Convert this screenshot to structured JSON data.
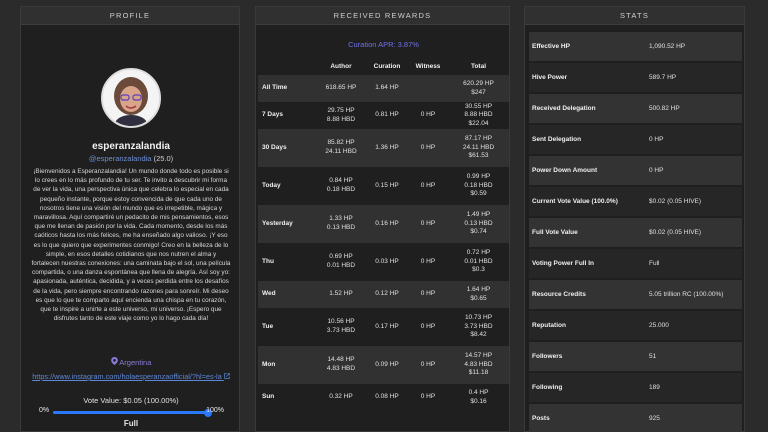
{
  "profile": {
    "header": "PROFILE",
    "name": "esperanzalandia",
    "handle": "@esperanzalandia",
    "reputation": "(25.0)",
    "about": "¡Bienvenidos a Esperanzalandia! Un mundo donde todo es posible si lo crees en lo más profundo de tu ser. Te invito a descubrir mi forma de ver la vida, una perspectiva única que celebra lo especial en cada pequeño instante, porque estoy convencida de que cada uno de nosotros tiene una visión del mundo que es irrepetible, mágica y maravillosa. Aquí compartiré un pedacito de mis pensamientos, esos que me llenan de pasión por la vida. Cada momento, desde los más caóticos hasta los más felices, me ha enseñado algo valioso. ¡Y eso es lo que quiero que experimentes conmigo! Creo en la belleza de lo simple, en esos detalles cotidianos que nos nutren el alma y fortalecen nuestras conexiones: una caminata bajo el sol, una película compartida, o una danza espontánea que llena de alegría. Así soy yo: apasionada, auténtica, decidida, y a veces perdida entre los desafíos de la vida, pero siempre encontrando razones para sonreír. Mi deseo es que lo que te comparto aquí encienda una chispa en tu corazón, que te inspire a unirte a este universo, mi universo. ¡Espero que disfrutes tanto de este viaje como yo lo hago cada día!",
    "location": "Argentina",
    "link": "https://www.instagram.com/holaesperanzaofficial/?hl=es-la",
    "vote_value": "Vote Value: $0.05 (100.00%)",
    "slider_min": "0%",
    "slider_max": "100%",
    "slider_value": 1.0,
    "power_label": "Full"
  },
  "rewards": {
    "header": "RECEIVED REWARDS",
    "apr": "Curation APR: 3.87%",
    "columns": [
      "",
      "Author",
      "Curation",
      "Witness",
      "Total"
    ],
    "rows": [
      {
        "label": "All Time",
        "author": [
          "618.65 HP"
        ],
        "curation": "1.64 HP",
        "witness": "",
        "total": [
          "620.29 HP",
          "$247"
        ]
      },
      {
        "label": "7 Days",
        "author": [
          "29.75 HP",
          "8.88 HBD"
        ],
        "curation": "0.81 HP",
        "witness": "0 HP",
        "total": [
          "30.55 HP",
          "8.88 HBD",
          "$22.04"
        ]
      },
      {
        "label": "30 Days",
        "author": [
          "85.82 HP",
          "24.11 HBD"
        ],
        "curation": "1.36 HP",
        "witness": "0 HP",
        "total": [
          "87.17 HP",
          "24.11 HBD",
          "$61.53"
        ]
      },
      {
        "label": "Today",
        "author": [
          "0.84 HP",
          "0.18 HBD"
        ],
        "curation": "0.15 HP",
        "witness": "0 HP",
        "total": [
          "0.99 HP",
          "0.18 HBD",
          "$0.59"
        ]
      },
      {
        "label": "Yesterday",
        "author": [
          "1.33 HP",
          "0.13 HBD"
        ],
        "curation": "0.16 HP",
        "witness": "0 HP",
        "total": [
          "1.49 HP",
          "0.13 HBD",
          "$0.74"
        ]
      },
      {
        "label": "Thu",
        "author": [
          "0.69 HP",
          "0.01 HBD"
        ],
        "curation": "0.03 HP",
        "witness": "0 HP",
        "total": [
          "0.72 HP",
          "0.01 HBD",
          "$0.3"
        ]
      },
      {
        "label": "Wed",
        "author": [
          "1.52 HP"
        ],
        "curation": "0.12 HP",
        "witness": "0 HP",
        "total": [
          "1.64 HP",
          "$0.65"
        ]
      },
      {
        "label": "Tue",
        "author": [
          "10.56 HP",
          "3.73 HBD"
        ],
        "curation": "0.17 HP",
        "witness": "0 HP",
        "total": [
          "10.73 HP",
          "3.73 HBD",
          "$8.42"
        ]
      },
      {
        "label": "Mon",
        "author": [
          "14.48 HP",
          "4.83 HBD"
        ],
        "curation": "0.09 HP",
        "witness": "0 HP",
        "total": [
          "14.57 HP",
          "4.83 HBD",
          "$11.18"
        ]
      },
      {
        "label": "Sun",
        "author": [
          "0.32 HP"
        ],
        "curation": "0.08 HP",
        "witness": "0 HP",
        "total": [
          "0.4 HP",
          "$0.16"
        ]
      }
    ]
  },
  "stats": {
    "header": "STATS",
    "rows": [
      {
        "key": "Effective HP",
        "value": "1,090.52 HP"
      },
      {
        "key": "Hive Power",
        "value": "589.7 HP"
      },
      {
        "key": "Received Delegation",
        "value": "500.82 HP"
      },
      {
        "key": "Sent Delegation",
        "value": "0 HP"
      },
      {
        "key": "Power Down Amount",
        "value": "0 HP"
      },
      {
        "key": "Current Vote Value (100.0%)",
        "value": "$0.02 (0.05 HIVE)"
      },
      {
        "key": "Full Vote Value",
        "value": "$0.02 (0.05 HIVE)"
      },
      {
        "key": "Voting Power Full In",
        "value": "Full"
      },
      {
        "key": "Resource Credits",
        "value": "5.05 trillion RC (100.00%)"
      },
      {
        "key": "Reputation",
        "value": "25.000"
      },
      {
        "key": "Followers",
        "value": "51"
      },
      {
        "key": "Following",
        "value": "189"
      },
      {
        "key": "Posts",
        "value": "925"
      }
    ]
  }
}
